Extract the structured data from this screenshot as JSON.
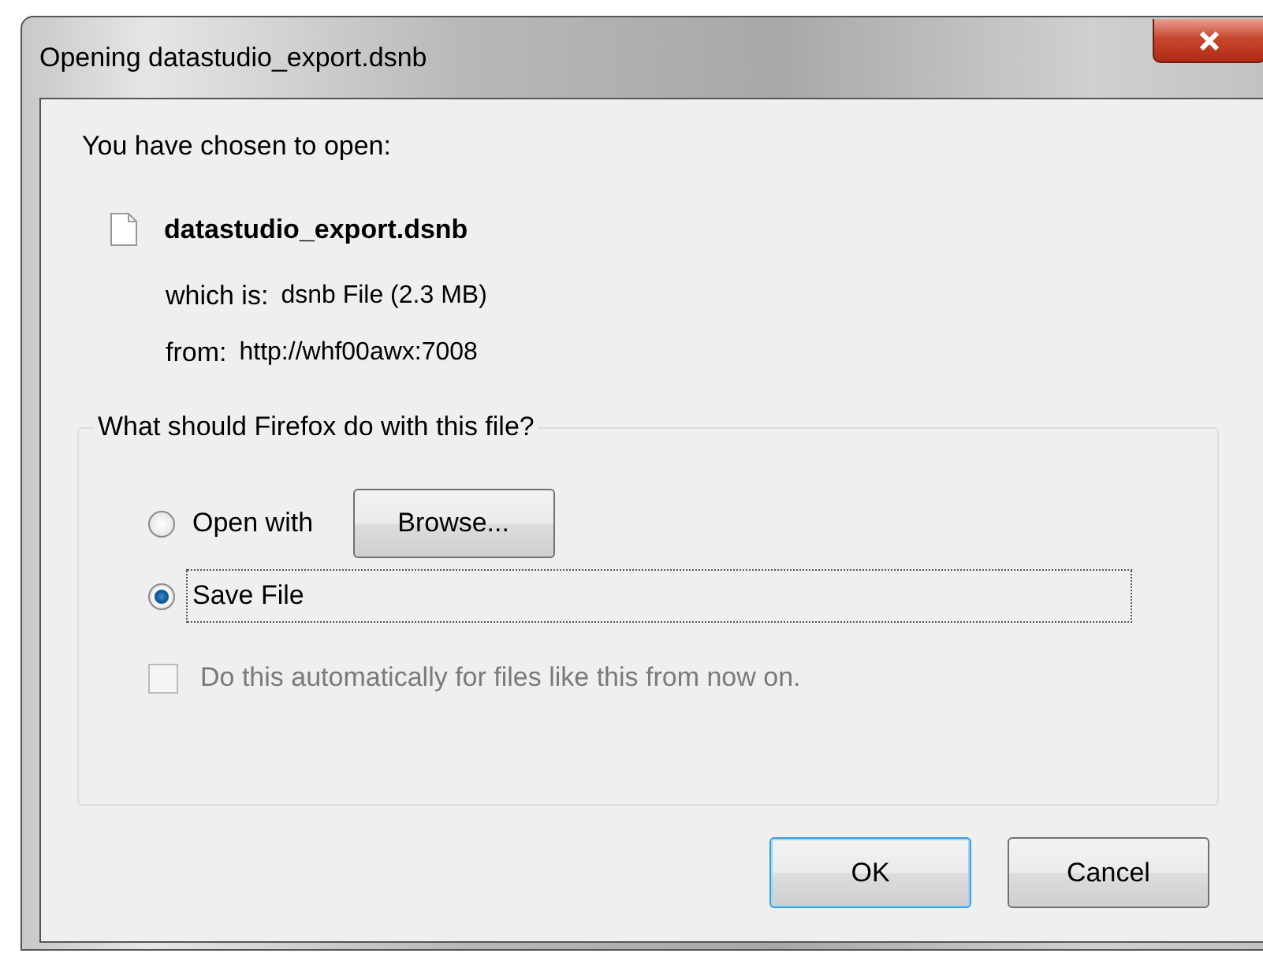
{
  "window": {
    "title": "Opening datastudio_export.dsnb"
  },
  "intro": "You have chosen to open:",
  "file": {
    "name": "datastudio_export.dsnb",
    "details": [
      {
        "label": "which is:",
        "value": "dsnb File (2.3 MB)"
      },
      {
        "label": "from:",
        "value": "http://whf00awx:7008"
      }
    ]
  },
  "action_group": {
    "legend": "What should Firefox do with this file?",
    "options": [
      {
        "label": "Open with",
        "selected": false,
        "focused": false,
        "button": "Browse..."
      },
      {
        "label": "Save File",
        "selected": true,
        "focused": true
      }
    ],
    "auto": {
      "label": "Do this automatically for files like this from now on.",
      "checked": false,
      "disabled": true
    }
  },
  "buttons": [
    {
      "label": "OK",
      "default": true
    },
    {
      "label": "Cancel",
      "default": false
    }
  ]
}
